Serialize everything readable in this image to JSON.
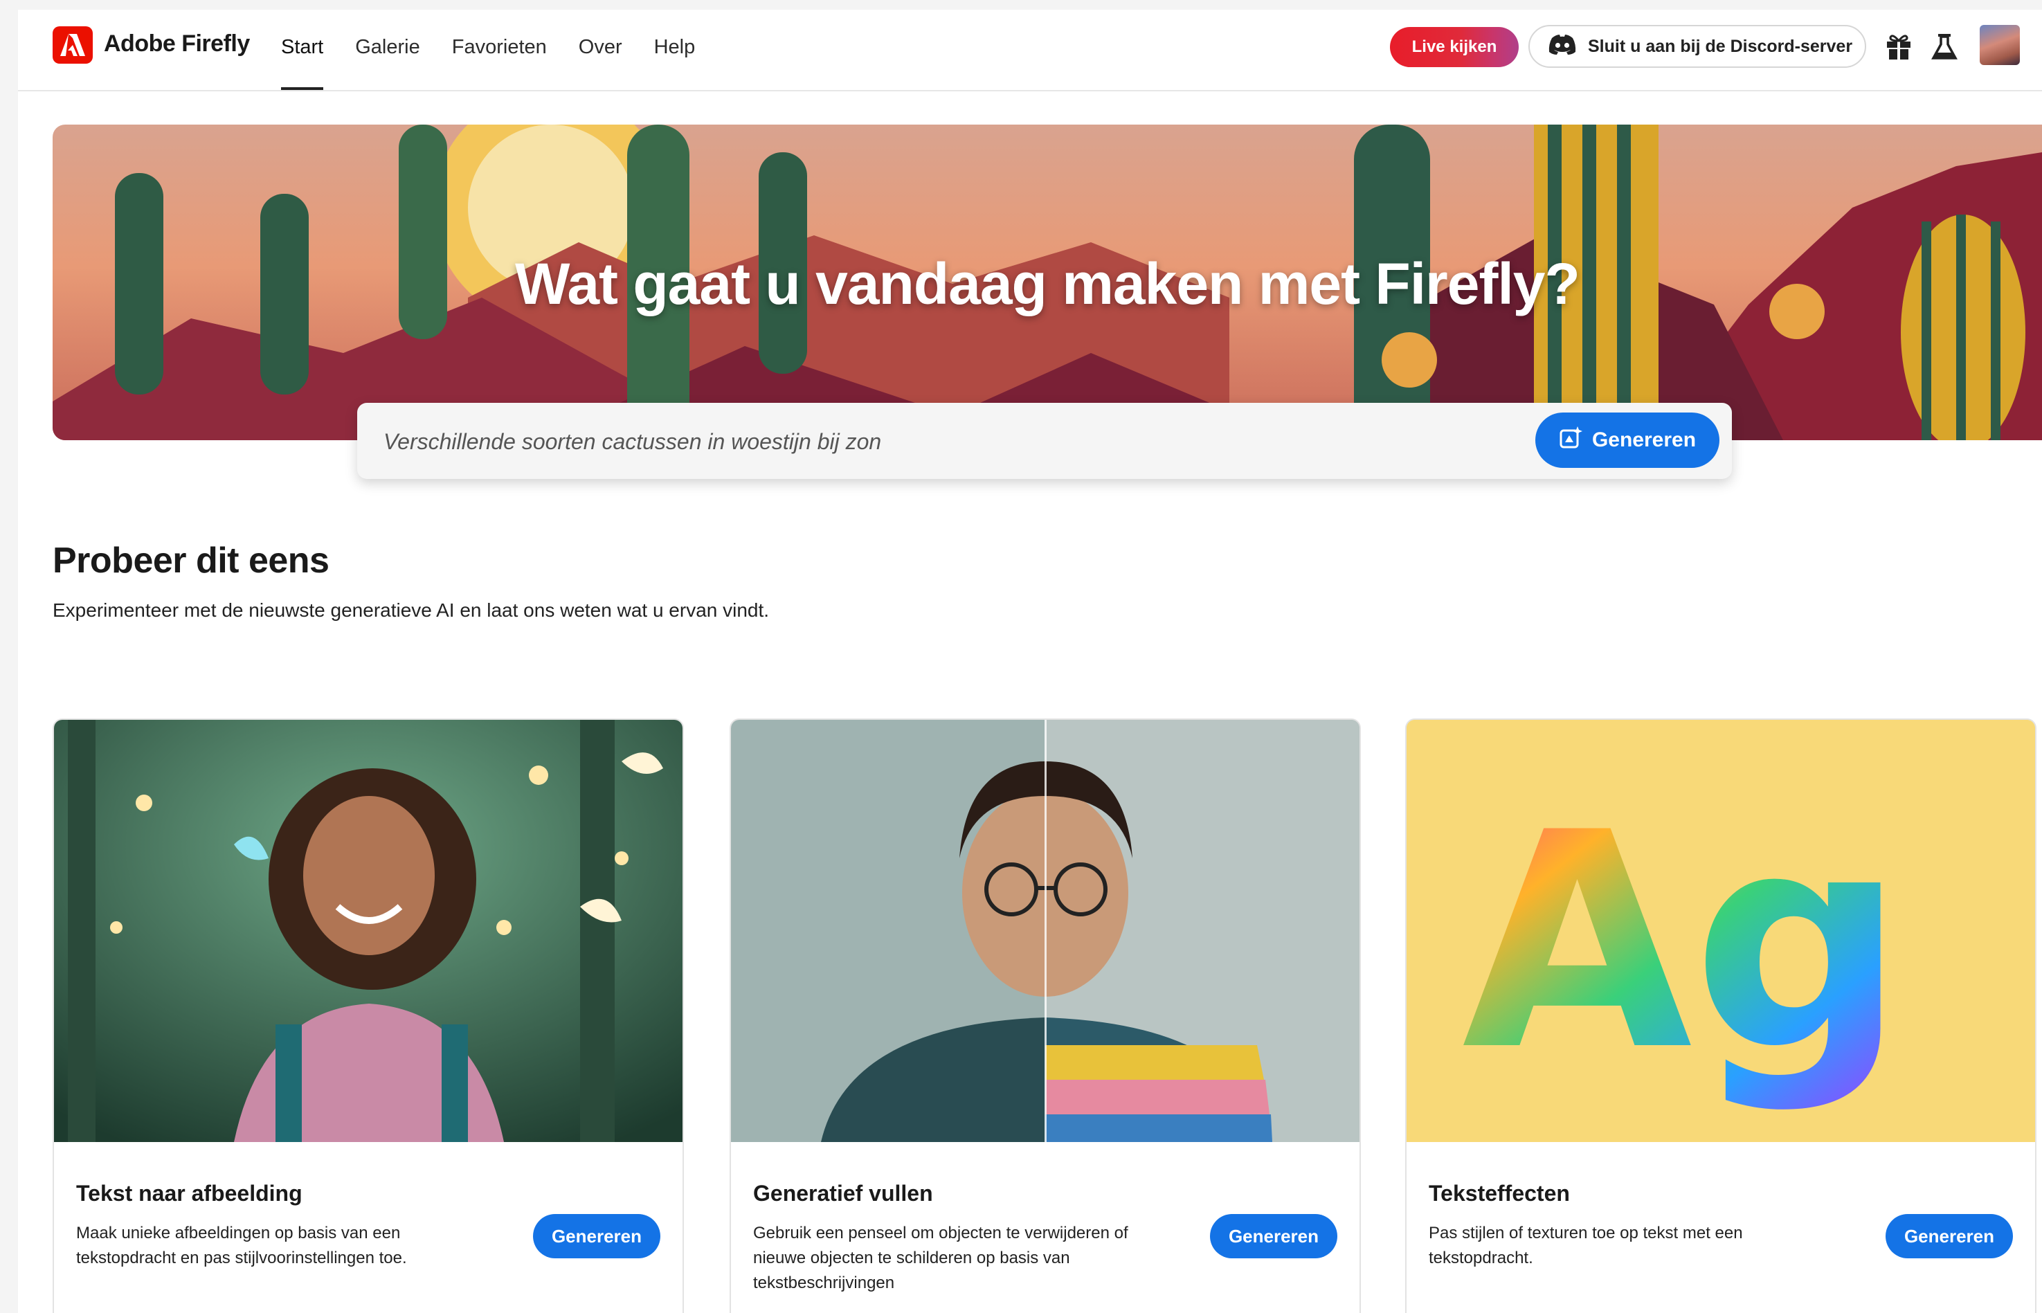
{
  "header": {
    "brand": "Adobe Firefly",
    "nav": [
      "Start",
      "Galerie",
      "Favorieten",
      "Over",
      "Help"
    ],
    "active_nav": "Start",
    "live_button": "Live kijken",
    "discord_button": "Sluit u aan bij de Discord-server"
  },
  "hero": {
    "title": "Wat gaat u vandaag maken met Firefly?",
    "prompt_value": "Verschillende soorten cactussen in woestijn bij zon",
    "generate_label": "Genereren"
  },
  "section": {
    "title": "Probeer dit eens",
    "subtitle": "Experimenteer met de nieuwste generatieve AI en laat ons weten wat u ervan vindt."
  },
  "cards": [
    {
      "title": "Tekst naar afbeelding",
      "description": "Maak unieke afbeeldingen op basis van een tekstopdracht en pas stijlvoorinstellingen toe.",
      "button": "Genereren"
    },
    {
      "title": "Generatief vullen",
      "description": "Gebruik een penseel om objecten te verwijderen of nieuwe objecten te schilderen op basis van tekstbeschrijvingen",
      "button": "Genereren"
    },
    {
      "title": "Teksteffecten",
      "description": "Pas stijlen of texturen toe op tekst met een tekstopdracht.",
      "button": "Genereren",
      "image_text": "Ag"
    }
  ],
  "colors": {
    "accent": "#1473e6",
    "brand_red": "#eb1000",
    "live_red": "#e81d2a"
  }
}
